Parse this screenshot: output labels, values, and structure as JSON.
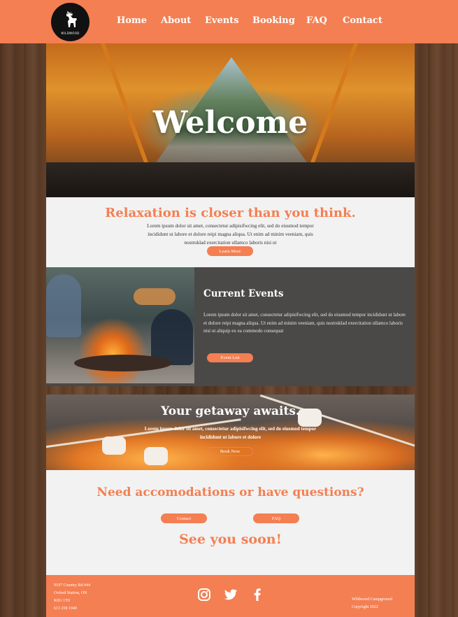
{
  "header": {
    "logo_text": "WILDWOOD",
    "nav": [
      "Home",
      "About",
      "Events",
      "Booking",
      "FAQ",
      "Contact"
    ]
  },
  "hero": {
    "title": "Welcome"
  },
  "intro": {
    "heading": "Relaxation is closer than you think.",
    "body": "Lorem ipsum dolor sit amet, consectetur adipisifwcing elit, sed do eiusmod tempor incididunt ut labore et dolore reipi magna aliqua. Ut enim ad minim veeniam, quis nostruklad exercitation ullamco laboris nisi ut",
    "button": "Learn More"
  },
  "events": {
    "heading": "Current Events",
    "body": "Lorem ipsum dolor sit amet, consectetur adipisifwcing elit, sed do eiusmod tempor incididunt ut labore et dolore reipi magna aliqua. Ut enim ad minim veeniam, quis nostruklad exercitation ullamco laboris nisi ut aliquip ex ea commodo consequat",
    "button": "Event List"
  },
  "getaway": {
    "heading": "Your getaway awaits.",
    "body": "Lorem ipsum dolor sit amet, consectetur adipisifwcing elit, sed do eiusmod tempor incididunt ut labore et dolore",
    "button": "Book Now"
  },
  "contact": {
    "heading": "Need accomodations or have questions?",
    "contact_button": "Contact",
    "faq_button": "FAQ",
    "closing": "See you soon!"
  },
  "footer": {
    "address_lines": [
      "9197 Country Rd #44",
      "Oxford Station, ON",
      "K0G 1T0",
      "613 258 1940"
    ],
    "copyright_lines": [
      "Wildwood Campground",
      "Copyright 2022"
    ],
    "social_icons": [
      "instagram-icon",
      "twitter-icon",
      "facebook-icon"
    ]
  },
  "colors": {
    "accent": "#f47f52",
    "dark_panel": "#4a4948",
    "light_panel": "#f2f2f2"
  }
}
